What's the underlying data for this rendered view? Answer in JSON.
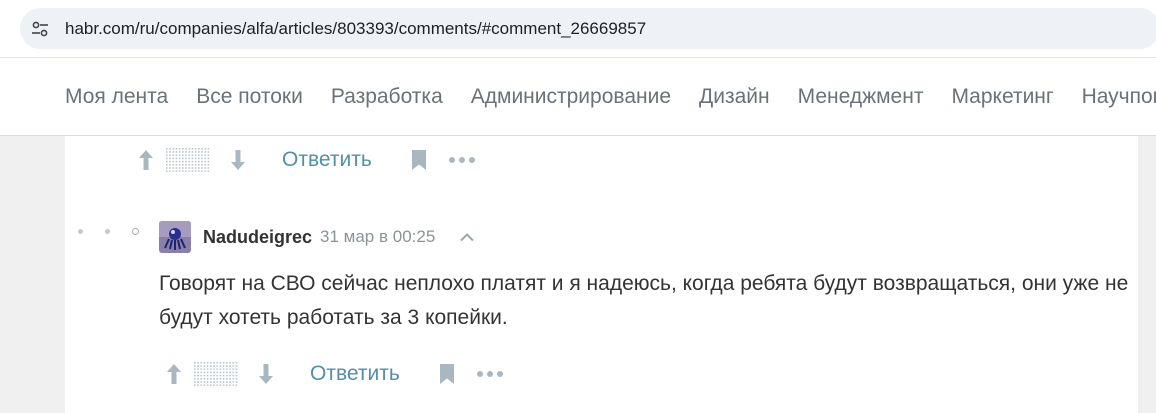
{
  "browser": {
    "url": "habr.com/ru/companies/alfa/articles/803393/comments/#comment_26669857",
    "site_info_icon": "tune-icon"
  },
  "nav": {
    "items": [
      {
        "label": "Моя лента"
      },
      {
        "label": "Все потоки"
      },
      {
        "label": "Разработка"
      },
      {
        "label": "Администрирование"
      },
      {
        "label": "Дизайн"
      },
      {
        "label": "Менеджмент"
      },
      {
        "label": "Маркетинг"
      },
      {
        "label": "Научпоп"
      }
    ]
  },
  "prev_comment_actions": {
    "reply_label": "Ответить"
  },
  "comment": {
    "username": "Nadudeigrec",
    "timestamp": "31 мар в 00:25",
    "text": "Говорят на СВО сейчас неплохо платят и я надеюсь, когда ребята будут возвращаться, они уже не будут хотеть работать за 3 копейки.",
    "reply_label": "Ответить"
  },
  "colors": {
    "accent": "#548eaa",
    "nav_text": "#6a7178",
    "icon_gray": "#a9b8c0"
  }
}
